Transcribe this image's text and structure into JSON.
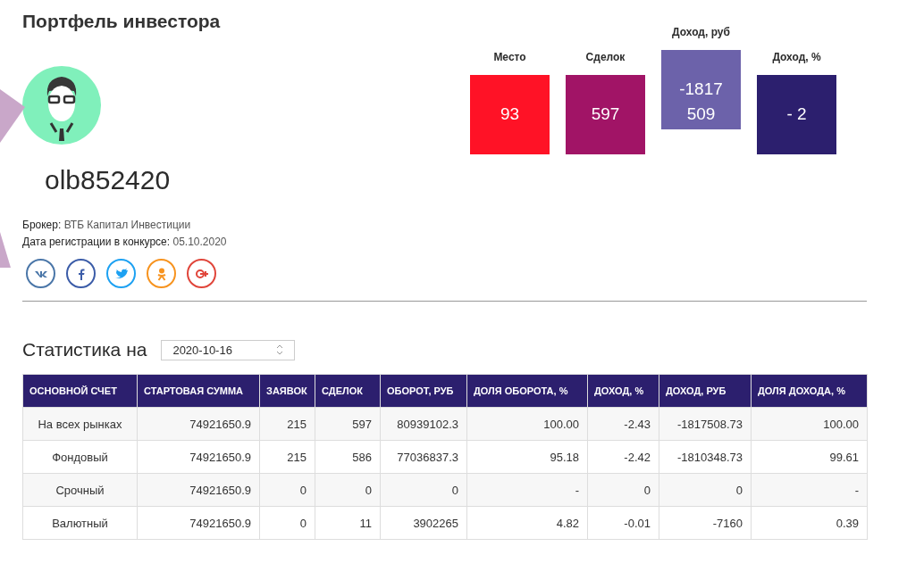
{
  "page_title": "Портфель инвестора",
  "stats": [
    {
      "label": "Место",
      "value": "93",
      "color": "#ff1226"
    },
    {
      "label": "Сделок",
      "value": "597",
      "color": "#a11466"
    },
    {
      "label": "Доход, руб",
      "value": "-1817 509",
      "color": "#6c62aa"
    },
    {
      "label": "Доход, %",
      "value": "- 2",
      "color": "#2c1f6e"
    }
  ],
  "username": "olb852420",
  "info": [
    {
      "label": "Брокер:",
      "value": "ВТБ Капитал Инвестиции"
    },
    {
      "label": "Дата регистрации в конкурсе:",
      "value": "05.10.2020"
    }
  ],
  "socials": [
    {
      "kind": "vk",
      "color": "#4a76a8"
    },
    {
      "kind": "facebook",
      "color": "#3b5ca8"
    },
    {
      "kind": "twitter",
      "color": "#1da1f2"
    },
    {
      "kind": "odnoklassniki",
      "color": "#f7931e"
    },
    {
      "kind": "googleplus",
      "color": "#e0453a"
    }
  ],
  "statistics": {
    "heading": "Статистика на",
    "date": "2020-10-16"
  },
  "table": {
    "columns": [
      "ОСНОВНОЙ СЧЕТ",
      "СТАРТОВАЯ СУММА",
      "ЗАЯВОК",
      "СДЕЛОК",
      "ОБОРОТ, РУБ",
      "ДОЛЯ ОБОРОТА, %",
      "ДОХОД, %",
      "ДОХОД, РУБ",
      "ДОЛЯ ДОХОДА, %"
    ],
    "rows": [
      [
        "На всех рынках",
        "74921650.9",
        "215",
        "597",
        "80939102.3",
        "100.00",
        "-2.43",
        "-1817508.73",
        "100.00"
      ],
      [
        "Фондовый",
        "74921650.9",
        "215",
        "586",
        "77036837.3",
        "95.18",
        "-2.42",
        "-1810348.73",
        "99.61"
      ],
      [
        "Срочный",
        "74921650.9",
        "0",
        "0",
        "0",
        "-",
        "0",
        "0",
        "-"
      ],
      [
        "Валютный",
        "74921650.9",
        "0",
        "11",
        "3902265",
        "4.82",
        "-0.01",
        "-7160",
        "0.39"
      ]
    ]
  }
}
